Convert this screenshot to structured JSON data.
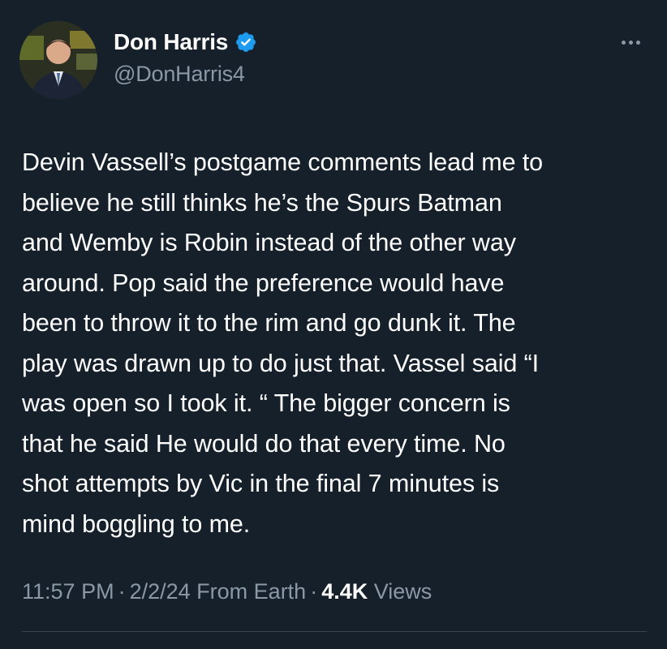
{
  "author": {
    "display_name": "Don Harris",
    "handle": "@DonHarris4",
    "verified": true,
    "avatar_icon": "profile-photo"
  },
  "more_icon": "more-horizontal-icon",
  "tweet": {
    "text": "Devin Vassell’s postgame comments lead me to\nbelieve he still thinks he’s the Spurs Batman\nand Wemby is Robin instead of the other way\naround. Pop said the preference would have\nbeen to throw it to the rim and go dunk it. The\nplay was drawn up to do just that. Vassel said “I\nwas open so I took it. “ The bigger concern is\nthat he said He would do that every time. No\nshot attempts by Vic in the final 7 minutes is\nmind boggling to me."
  },
  "meta": {
    "time": "11:57 PM",
    "separator": "·",
    "date": "2/2/24",
    "source": "From Earth",
    "views_count": "4.4K",
    "views_label": "Views"
  },
  "colors": {
    "background": "#15202b",
    "text": "#ffffff",
    "secondary_text": "#8b98a5",
    "verified_blue": "#1d9bf0",
    "divider": "#38444d"
  }
}
